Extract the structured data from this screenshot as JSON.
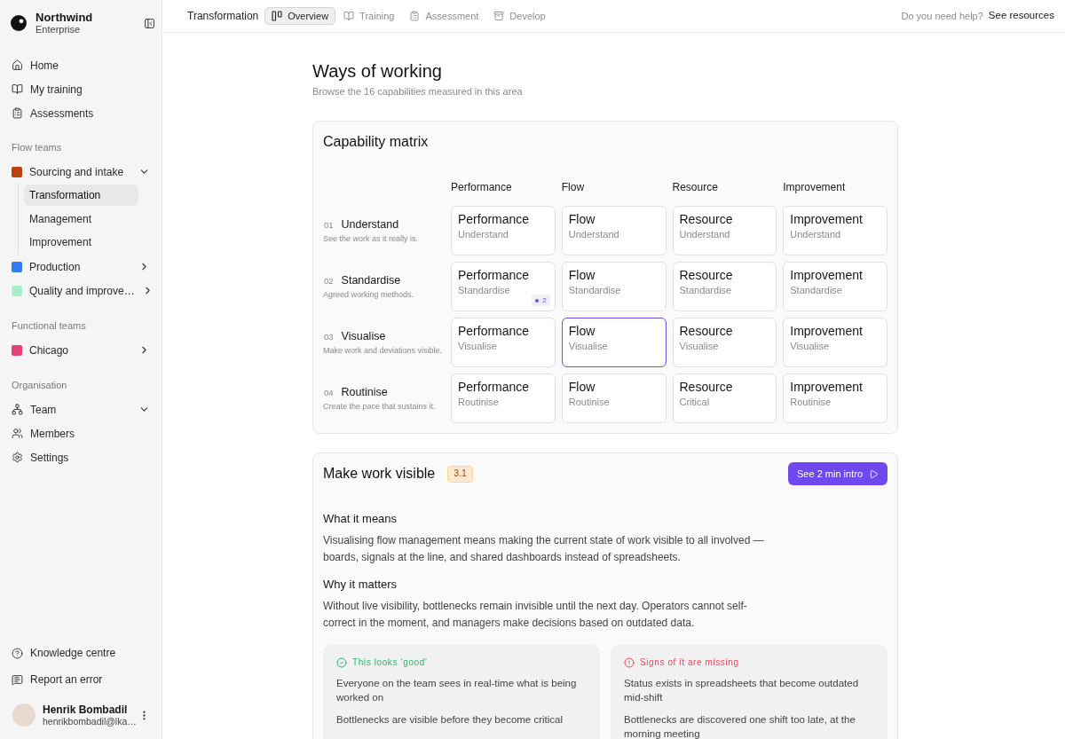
{
  "sidebar": {
    "brand": {
      "name": "Northwind",
      "subtitle": "Enterprise"
    },
    "nav": [
      "Home",
      "My training",
      "Assessments"
    ],
    "sections": [
      {
        "title": "Flow teams",
        "items": [
          {
            "kind": "team",
            "label": "Sourcing and intake",
            "color": "#b8430f",
            "expanded": true,
            "children": [
              {
                "label": "Transformation",
                "selected": true
              },
              {
                "label": "Management",
                "selected": false
              },
              {
                "label": "Improvement",
                "selected": false
              }
            ]
          },
          {
            "kind": "team",
            "label": "Production",
            "color": "#2f7cf6",
            "expanded": false
          },
          {
            "kind": "team",
            "label": "Quality and improve…",
            "color": "#a8efc9",
            "expanded": false
          }
        ]
      },
      {
        "title": "Functional teams",
        "items": [
          {
            "kind": "team",
            "label": "Chicago",
            "color": "#e5407a",
            "expanded": false
          }
        ]
      },
      {
        "title": "Organisation",
        "items": [
          {
            "kind": "menu",
            "label": "Team",
            "expanded": true,
            "children": [
              {
                "label": "Members"
              },
              {
                "label": "Settings"
              }
            ]
          }
        ]
      }
    ],
    "footer_links": [
      "Knowledge centre",
      "Report an error"
    ],
    "user": {
      "name": "Henrik Bombadil",
      "email": "henrikbombadil@lka…"
    }
  },
  "topbar": {
    "title": "Transformation",
    "tabs": [
      {
        "label": "Overview",
        "selected": true
      },
      {
        "label": "Training",
        "selected": false
      },
      {
        "label": "Assessment",
        "selected": false
      },
      {
        "label": "Develop",
        "selected": false
      }
    ],
    "help_text": "Do you need help?",
    "help_link": "See resources"
  },
  "page": {
    "title": "Ways of working",
    "subtitle": "Browse the 16 capabilities measured in this area"
  },
  "matrix": {
    "title": "Capability matrix",
    "columns": [
      "Performance",
      "Flow",
      "Resource",
      "Improvement"
    ],
    "rows": [
      {
        "number": "01",
        "name": "Understand",
        "description": "See the work as it really is.",
        "cells": [
          {
            "title": "Performance",
            "subtitle": "Understand",
            "selected": false
          },
          {
            "title": "Flow",
            "subtitle": "Understand",
            "selected": false
          },
          {
            "title": "Resource",
            "subtitle": "Understand",
            "selected": false
          },
          {
            "title": "Improvement",
            "subtitle": "Understand",
            "selected": false
          }
        ]
      },
      {
        "number": "02",
        "name": "Standardise",
        "description": "Agreed working methods.",
        "cells": [
          {
            "title": "Performance",
            "subtitle": "Standardise",
            "selected": false,
            "badge": "2"
          },
          {
            "title": "Flow",
            "subtitle": "Standardise",
            "selected": false
          },
          {
            "title": "Resource",
            "subtitle": "Standardise",
            "selected": false
          },
          {
            "title": "Improvement",
            "subtitle": "Standardise",
            "selected": false
          }
        ]
      },
      {
        "number": "03",
        "name": "Visualise",
        "description": "Make work and deviations visible.",
        "cells": [
          {
            "title": "Performance",
            "subtitle": "Visualise",
            "selected": false
          },
          {
            "title": "Flow",
            "subtitle": "Visualise",
            "selected": true
          },
          {
            "title": "Resource",
            "subtitle": "Visualise",
            "selected": false
          },
          {
            "title": "Improvement",
            "subtitle": "Visualise",
            "selected": false
          }
        ]
      },
      {
        "number": "04",
        "name": "Routinise",
        "description": "Create the pace that sustains it.",
        "cells": [
          {
            "title": "Performance",
            "subtitle": "Routinise",
            "selected": false
          },
          {
            "title": "Flow",
            "subtitle": "Routinise",
            "selected": false
          },
          {
            "title": "Resource",
            "subtitle": "Critical",
            "selected": false
          },
          {
            "title": "Improvement",
            "subtitle": "Routinise",
            "selected": false
          }
        ]
      }
    ]
  },
  "detail": {
    "title": "Make work visible",
    "badge": "3.1",
    "button": "See 2 min intro",
    "sections": [
      {
        "heading": "What it means",
        "text": "Visualising flow management means making the current state of work visible to all involved — boards, signals at the line, and shared dashboards instead of spreadsheets."
      },
      {
        "heading": "Why it matters",
        "text": "Without live visibility, bottlenecks remain invisible until the next day. Operators cannot self-correct in the moment, and managers make decisions based on outdated data."
      }
    ],
    "lists": [
      {
        "kind": "good",
        "title": "This looks ‘good’",
        "items": [
          "Everyone on the team sees in real-time what is being worked on",
          "Bottlenecks are visible before they become critical"
        ]
      },
      {
        "kind": "missing",
        "title": "Signs of it are missing",
        "items": [
          "Status exists in spreadsheets that become outdated mid-shift",
          "Bottlenecks are discovered one shift too late, at the morning meeting"
        ]
      }
    ]
  }
}
